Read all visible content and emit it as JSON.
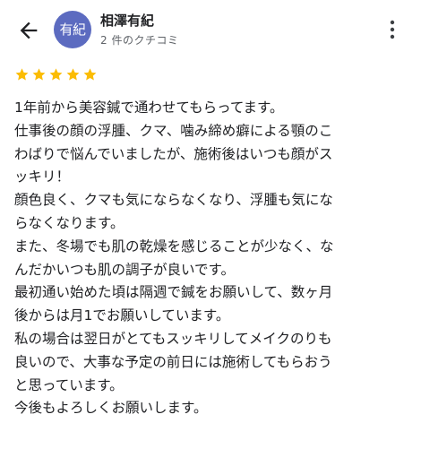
{
  "header": {
    "back_icon": "arrow-back-icon",
    "avatar_text": "有紀",
    "avatar_color": "#5c6bc0",
    "author_name": "相澤有紀",
    "review_count": "2 件のクチコミ",
    "more_icon": "more-vert-icon"
  },
  "review": {
    "rating": 5,
    "star_color": "#fbbc04",
    "lines": [
      "1年前から美容鍼で通わせてもらってます。",
      "仕事後の顔の浮腫、クマ、噛み締め癖による顎のこ",
      "わばりで悩んでいましたが、施術後はいつも顔がス",
      "ッキリ！",
      "顔色良く、クマも気にならなくなり、浮腫も気にな",
      "らなくなります。",
      "また、冬場でも肌の乾燥を感じることが少なく、な",
      "んだかいつも肌の調子が良いです。",
      "最初通い始めた頃は隔週で鍼をお願いして、数ヶ月",
      "後からは月1でお願いしています。",
      "私の場合は翌日がとてもスッキリしてメイクのりも",
      "良いので、大事な予定の前日には施術してもらおう",
      "と思っています。",
      "今後もよろしくお願いします。"
    ]
  }
}
